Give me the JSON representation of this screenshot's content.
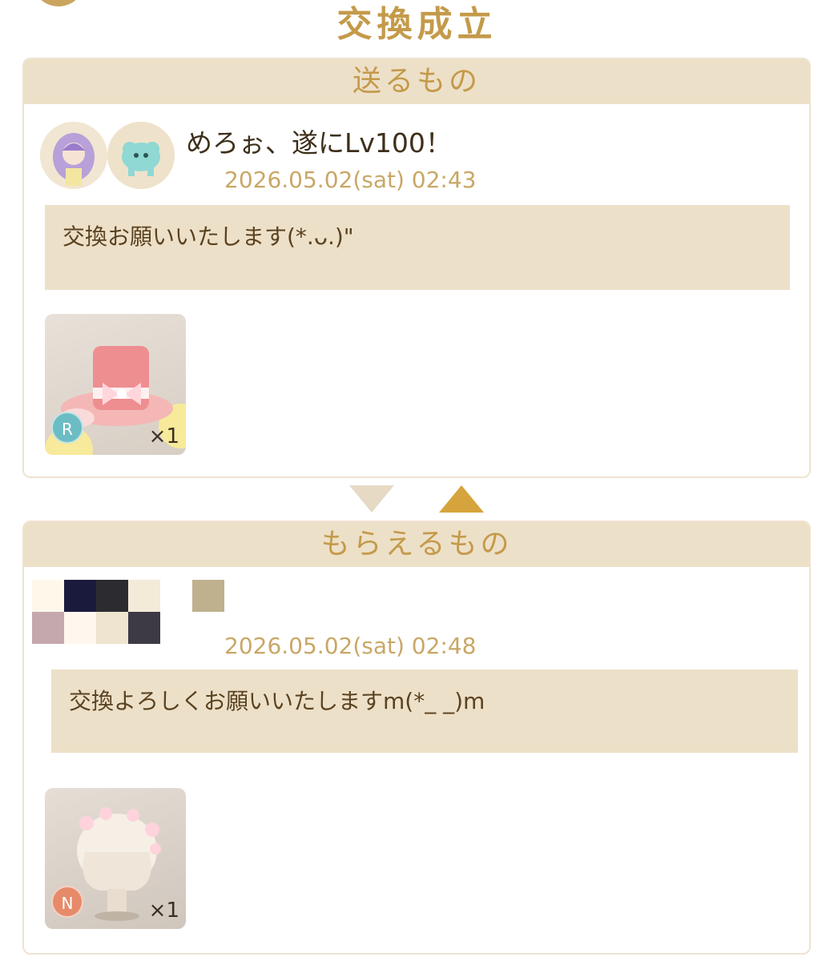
{
  "title": "交換成立",
  "send": {
    "header": "送るもの",
    "username": "めろぉ、遂にLv100！",
    "timestamp": "2026.05.02(sat) 02:43",
    "message": "交換お願いいたします(*.ᴗ.)\"",
    "item": {
      "rarity": "R",
      "quantity": "×1",
      "icon": "pink-top-hat-icon"
    }
  },
  "receive": {
    "header": "もらえるもの",
    "timestamp": "2026.05.02(sat) 02:48",
    "message": "交換よろしくお願いいたしますm(*_ _)m",
    "item": {
      "rarity": "N",
      "quantity": "×1",
      "icon": "flower-wig-icon"
    }
  },
  "colors": {
    "gold": "#c49a4a",
    "header_bg": "#ede0c8",
    "rarity_r": "#6cbcc4",
    "rarity_n": "#e68a6a"
  }
}
